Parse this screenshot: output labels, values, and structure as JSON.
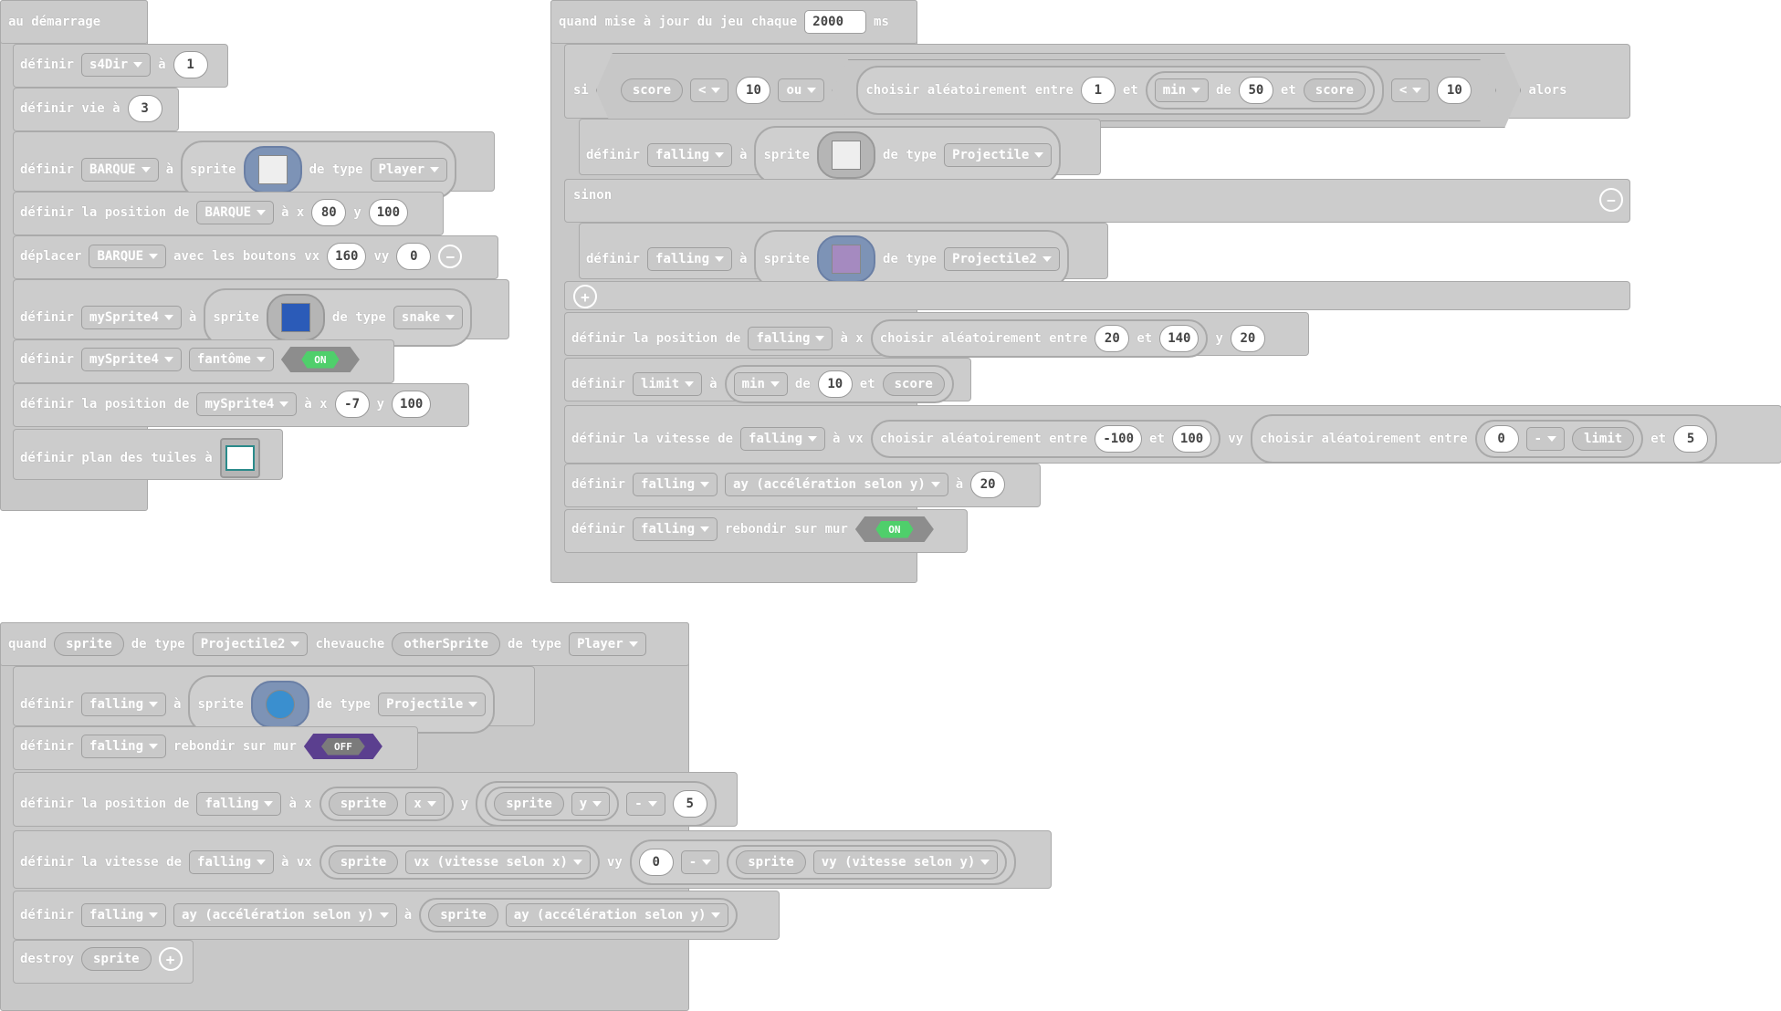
{
  "on_start": {
    "hat": "au démarrage",
    "rows": {
      "r1": {
        "kw": "définir",
        "var": "s4Dir",
        "to": "à",
        "val": "1"
      },
      "r2": {
        "kw": "définir vie à",
        "val": "3"
      },
      "r3": {
        "kw": "définir",
        "var": "BARQUE",
        "to": "à",
        "sprite": "sprite",
        "of_type": "de type",
        "kind": "Player"
      },
      "r4": {
        "kw": "définir la position de",
        "var": "BARQUE",
        "to": "à x",
        "x": "80",
        "y_label": "y",
        "y": "100"
      },
      "r5": {
        "kw": "déplacer",
        "var": "BARQUE",
        "text": "avec les boutons vx",
        "vx": "160",
        "vy_label": "vy",
        "vy": "0"
      },
      "r6": {
        "kw": "définir",
        "var": "mySprite4",
        "to": "à",
        "sprite": "sprite",
        "of_type": "de type",
        "kind": "snake"
      },
      "r7": {
        "kw": "définir",
        "var": "mySprite4",
        "prop": "fantôme",
        "toggle": "ON"
      },
      "r8": {
        "kw": "définir la position de",
        "var": "mySprite4",
        "to": "à x",
        "x": "-7",
        "y_label": "y",
        "y": "100"
      },
      "r9": {
        "kw": "définir plan des tuiles à"
      }
    }
  },
  "update": {
    "hat": {
      "when": "quand mise à jour du jeu chaque",
      "interval": "2000",
      "unit": "ms"
    },
    "if": {
      "si": "si",
      "score": "score",
      "op1": "<",
      "v1": "10",
      "or": "ou",
      "random": "choisir aléatoirement entre",
      "a": "1",
      "and": "et",
      "min": "min",
      "de": "de",
      "b": "50",
      "and2": "et",
      "score2": "score",
      "op2": "<",
      "v2": "10",
      "then": "alors"
    },
    "branch1": {
      "kw": "définir",
      "var": "falling",
      "to": "à",
      "sprite": "sprite",
      "of_type": "de type",
      "kind": "Projectile"
    },
    "else": "sinon",
    "branch2": {
      "kw": "définir",
      "var": "falling",
      "to": "à",
      "sprite": "sprite",
      "of_type": "de type",
      "kind": "Projectile2"
    },
    "pos": {
      "kw": "définir la position de",
      "var": "falling",
      "to": "à x",
      "random": "choisir aléatoirement entre",
      "a": "20",
      "and": "et",
      "b": "140",
      "y_label": "y",
      "y": "20"
    },
    "limit": {
      "kw": "définir",
      "var": "limit",
      "to": "à",
      "min": "min",
      "de": "de",
      "v": "10",
      "and": "et",
      "score": "score"
    },
    "vel": {
      "kw": "définir la vitesse de",
      "var": "falling",
      "to": "à vx",
      "random": "choisir aléatoirement entre",
      "a": "-100",
      "and": "et",
      "b": "100",
      "vy": "vy",
      "random2": "choisir aléatoirement entre",
      "c": "0",
      "minus": "-",
      "limit": "limit",
      "and2": "et",
      "d": "5"
    },
    "accel": {
      "kw": "définir",
      "var": "falling",
      "prop": "ay (accélération selon y)",
      "to": "à",
      "v": "20"
    },
    "bounce": {
      "kw": "définir",
      "var": "falling",
      "text": "rebondir sur mur",
      "toggle": "ON"
    }
  },
  "overlap": {
    "hat": {
      "when": "quand",
      "s1": "sprite",
      "of": "de type",
      "k1": "Projectile2",
      "overlaps": "chevauche",
      "s2": "otherSprite",
      "of2": "de type",
      "k2": "Player"
    },
    "r1": {
      "kw": "définir",
      "var": "falling",
      "to": "à",
      "sprite": "sprite",
      "of_type": "de type",
      "kind": "Projectile"
    },
    "r2": {
      "kw": "définir",
      "var": "falling",
      "text": "rebondir sur mur",
      "toggle": "OFF"
    },
    "r3": {
      "kw": "définir la position de",
      "var": "falling",
      "to": "à x",
      "s": "sprite",
      "x": "x",
      "y_label": "y",
      "s2": "sprite",
      "y": "y",
      "minus": "-",
      "v": "5"
    },
    "r4": {
      "kw": "définir la vitesse de",
      "var": "falling",
      "to": "à vx",
      "s": "sprite",
      "vx": "vx (vitesse selon x)",
      "vy_label": "vy",
      "zero": "0",
      "minus": "-",
      "s2": "sprite",
      "vy": "vy (vitesse selon y)"
    },
    "r5": {
      "kw": "définir",
      "var": "falling",
      "prop": "ay (accélération selon y)",
      "to": "à",
      "s": "sprite",
      "prop2": "ay (accélération selon y)"
    },
    "r6": {
      "kw": "destroy",
      "s": "sprite"
    }
  }
}
